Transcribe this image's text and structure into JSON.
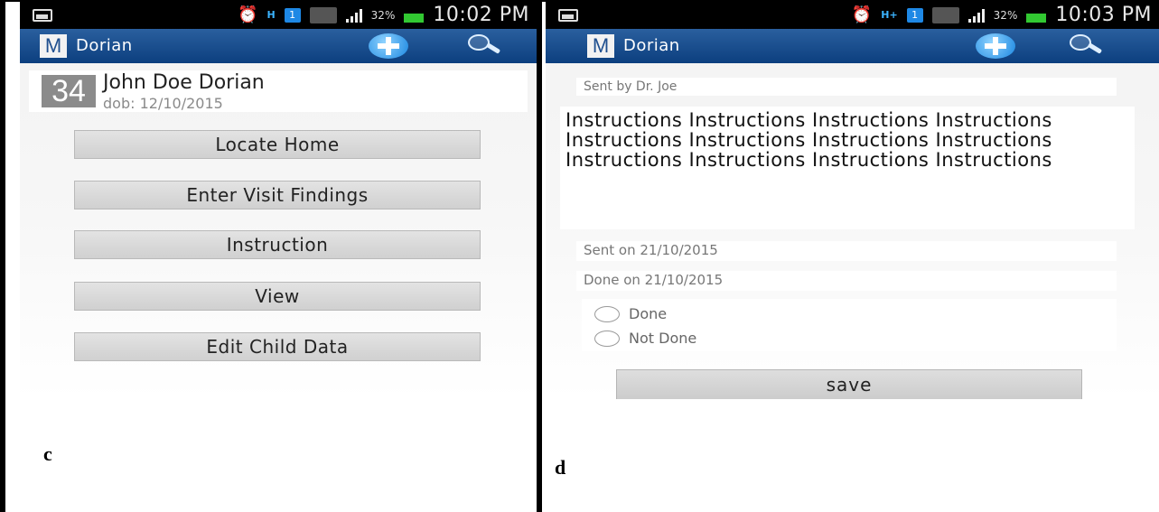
{
  "panel_c": {
    "status_bar": {
      "time": "10:02 PM",
      "battery_percent": "32%",
      "network_letter": "H",
      "sim": "1"
    },
    "action_bar": {
      "logo_letter": "M",
      "title": "Dorian"
    },
    "child": {
      "age": "34",
      "name": "John Doe Dorian",
      "dob": "dob: 12/10/2015"
    },
    "menu": [
      {
        "label": "Locate Home"
      },
      {
        "label": "Enter Visit Findings"
      },
      {
        "label": "Instruction"
      },
      {
        "label": "View"
      },
      {
        "label": "Edit Child Data"
      }
    ],
    "caption": "c"
  },
  "panel_d": {
    "status_bar": {
      "time": "10:03 PM",
      "battery_percent": "32%",
      "network_letter": "H+",
      "sim": "1"
    },
    "action_bar": {
      "logo_letter": "M",
      "title": "Dorian"
    },
    "sent_by": "Sent by Dr. Joe",
    "instructions": "Instructions Instructions Instructions Instructions Instructions Instructions Instructions Instructions Instructions Instructions Instructions Instructions",
    "sent_on": "Sent on 21/10/2015",
    "done_on": "Done on 21/10/2015",
    "options": [
      {
        "label": "Done",
        "selected": false
      },
      {
        "label": "Not Done",
        "selected": false
      }
    ],
    "save_label": "save",
    "caption": "d"
  },
  "colors": {
    "action_bar": "#0c3f7f",
    "add_button": "#1a86e0",
    "battery": "#32c832"
  },
  "icons": [
    "picture-icon",
    "alarm-icon",
    "signal-icon",
    "sim-icon",
    "wifi-icon",
    "battery-icon",
    "add-icon",
    "search-icon"
  ]
}
